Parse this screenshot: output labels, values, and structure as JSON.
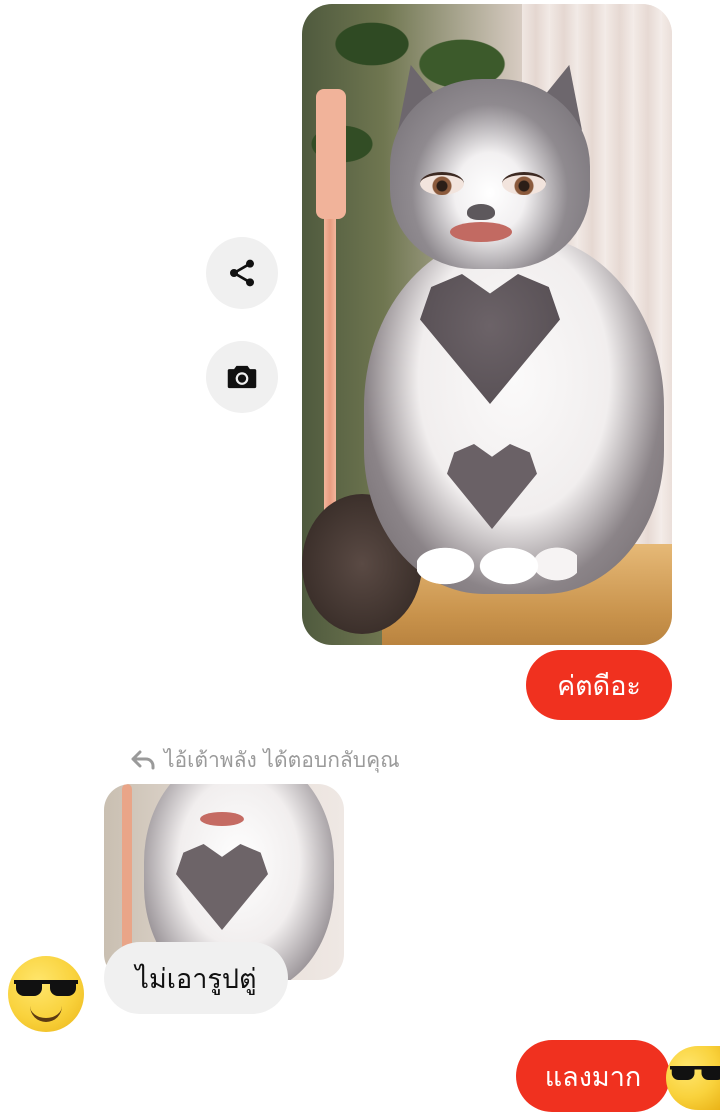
{
  "sent_photo": {
    "subject": "cat photo with heart-shaped marking"
  },
  "actions": {
    "share_icon": "share-icon",
    "camera_icon": "camera-icon"
  },
  "messages": {
    "sent_1": "ค่ตดีอะ",
    "reply_header": "ไอ้เต้าพลัง ได้ตอบกลับคุณ",
    "received_1": "ไม่เอารูปตู่",
    "sent_2": "แลงมาก"
  },
  "colors": {
    "sent_bubble": "#f0311f",
    "received_bubble": "#f0f0f0",
    "reply_header_text": "#9a9a9a"
  }
}
